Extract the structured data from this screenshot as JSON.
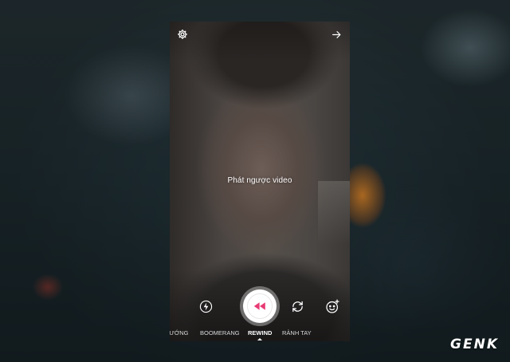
{
  "camera": {
    "mode_hint": "Phát ngược video",
    "modes": [
      "HƯỚNG",
      "BOOMERANG",
      "REWIND",
      "RẢNH TAY"
    ],
    "active_mode": "REWIND"
  },
  "icons": {
    "settings": "gear-icon",
    "next": "arrow-right-icon",
    "flash": "flash-icon",
    "shutter": "rewind-icon",
    "switch_camera": "switch-camera-icon",
    "face_filters": "face-filter-icon"
  },
  "colors": {
    "rewind_accent": "#e83a74",
    "text": "#ffffff"
  },
  "watermark": "GENK"
}
